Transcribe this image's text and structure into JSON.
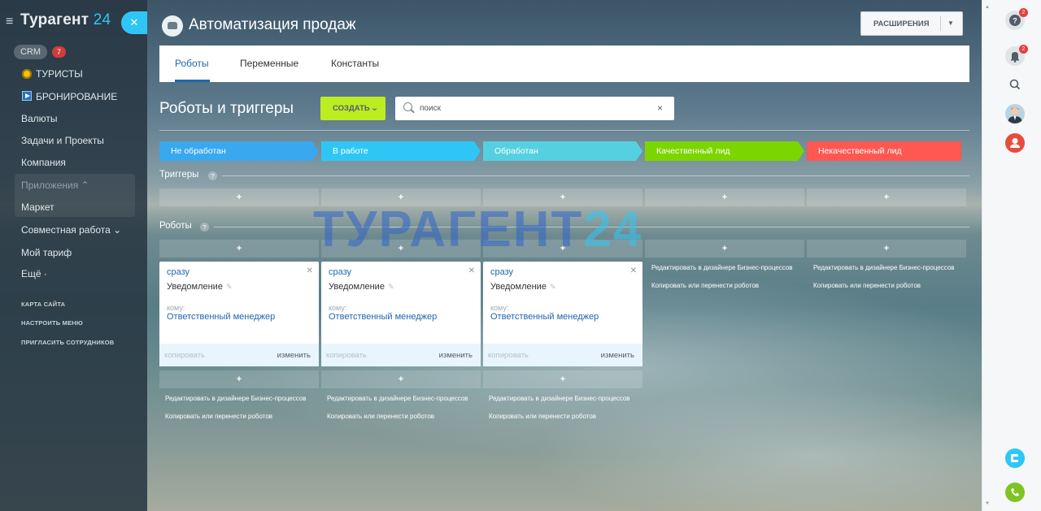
{
  "app": {
    "logo_main": "Турагент",
    "logo_num": "24"
  },
  "leftmenu": {
    "crm_label": "CRM",
    "crm_count": "7",
    "items": [
      {
        "label": "ТУРИСТЫ"
      },
      {
        "label": "БРОНИРОВАНИЕ"
      },
      {
        "label": "Валюты"
      },
      {
        "label": "Задачи и Проекты"
      },
      {
        "label": "Компания"
      },
      {
        "label": "Приложения ⌃"
      },
      {
        "label": "Маркет"
      },
      {
        "label": "Совместная работа ⌄"
      },
      {
        "label": "Мой тариф"
      },
      {
        "label": "Ещё ·"
      }
    ],
    "footer": [
      {
        "label": "КАРТА САЙТА"
      },
      {
        "label": "НАСТРОИТЬ МЕНЮ"
      },
      {
        "label": "ПРИГЛАСИТЬ СОТРУДНИКОВ"
      }
    ]
  },
  "header": {
    "title": "Автоматизация продаж",
    "ext_label": "РАСШИРЕНИЯ"
  },
  "tabs": [
    {
      "label": "Роботы",
      "active": true
    },
    {
      "label": "Переменные"
    },
    {
      "label": "Константы"
    }
  ],
  "toolbar": {
    "section_title": "Роботы и триггеры",
    "create_label": "СОЗДАТЬ",
    "search_placeholder": "поиск",
    "clear_icon": "×"
  },
  "stages": [
    {
      "label": "Не обработан",
      "color": "#39a8ef"
    },
    {
      "label": "В работе",
      "color": "#2fc6f6"
    },
    {
      "label": "Обработан",
      "color": "#55d0e0"
    },
    {
      "label": "Качественный лид",
      "color": "#7bd500"
    },
    {
      "label": "Некачественный лид",
      "color": "#ff5752"
    }
  ],
  "sections": {
    "triggers": "Триггеры",
    "robots": "Роботы",
    "help": "?",
    "add": "+"
  },
  "cards": [
    {
      "when": "сразу",
      "name": "Уведомление",
      "to_label": "кому:",
      "to": "Ответственный менеджер",
      "copy": "копировать",
      "change": "изменить"
    },
    {
      "when": "сразу",
      "name": "Уведомление",
      "to_label": "кому:",
      "to": "Ответственный менеджер",
      "copy": "копировать",
      "change": "изменить"
    },
    {
      "when": "сразу",
      "name": "Уведомление",
      "to_label": "кому:",
      "to": "Ответственный менеджер",
      "copy": "копировать",
      "change": "изменить"
    }
  ],
  "links": {
    "edit_designer": "Редактировать в дизайнере Бизнес-процессов",
    "copy_move": "Копировать или перенести роботов"
  },
  "watermark": {
    "main": "ТУРАГЕНТ",
    "num": "24"
  },
  "rightbar": {
    "help_badge": "2",
    "notify_badge": "2",
    "colors": {
      "accent": "#2fc6f6",
      "danger": "#e43f3f",
      "phone": "#7fc423"
    }
  }
}
